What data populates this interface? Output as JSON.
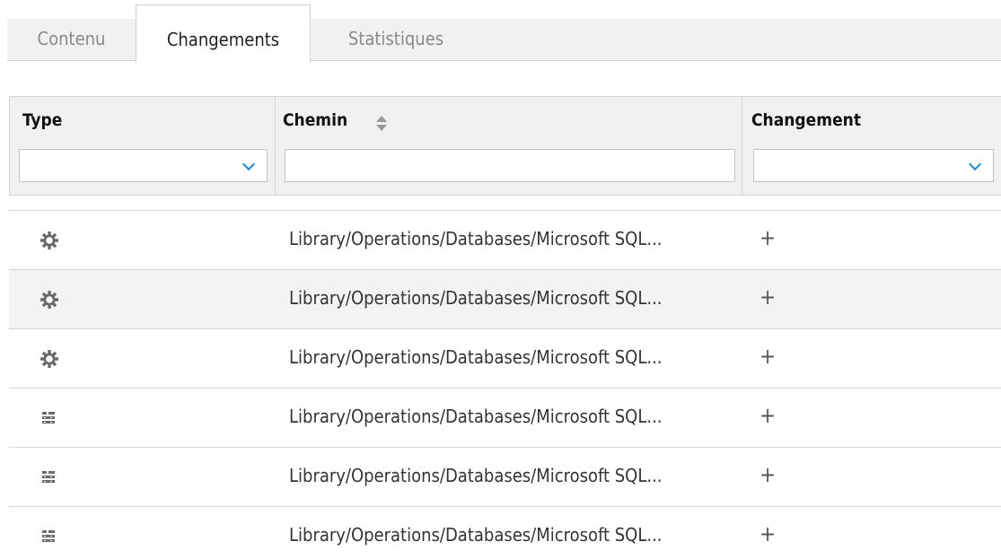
{
  "tabs": [
    {
      "label": "Contenu",
      "active": false
    },
    {
      "label": "Changements",
      "active": true
    },
    {
      "label": "Statistiques",
      "active": false
    }
  ],
  "columns": {
    "type": {
      "label": "Type",
      "filter_value": ""
    },
    "path": {
      "label": "Chemin",
      "filter_value": ""
    },
    "change": {
      "label": "Changement",
      "filter_value": ""
    }
  },
  "rows": [
    {
      "icon": "gear-icon",
      "path": "Library/Operations/Databases/Microsoft SQL...",
      "change": "+"
    },
    {
      "icon": "gear-icon",
      "path": "Library/Operations/Databases/Microsoft SQL...",
      "change": "+"
    },
    {
      "icon": "gear-icon",
      "path": "Library/Operations/Databases/Microsoft SQL...",
      "change": "+"
    },
    {
      "icon": "structure-icon",
      "path": "Library/Operations/Databases/Microsoft SQL...",
      "change": "+"
    },
    {
      "icon": "structure-icon",
      "path": "Library/Operations/Databases/Microsoft SQL...",
      "change": "+"
    },
    {
      "icon": "structure-icon",
      "path": "Library/Operations/Databases/Microsoft SQL...",
      "change": "+"
    }
  ],
  "colors": {
    "accent": "#1f8dd6",
    "header_bg": "#f1f1f1",
    "alt_row_bg": "#f3f3f3"
  }
}
